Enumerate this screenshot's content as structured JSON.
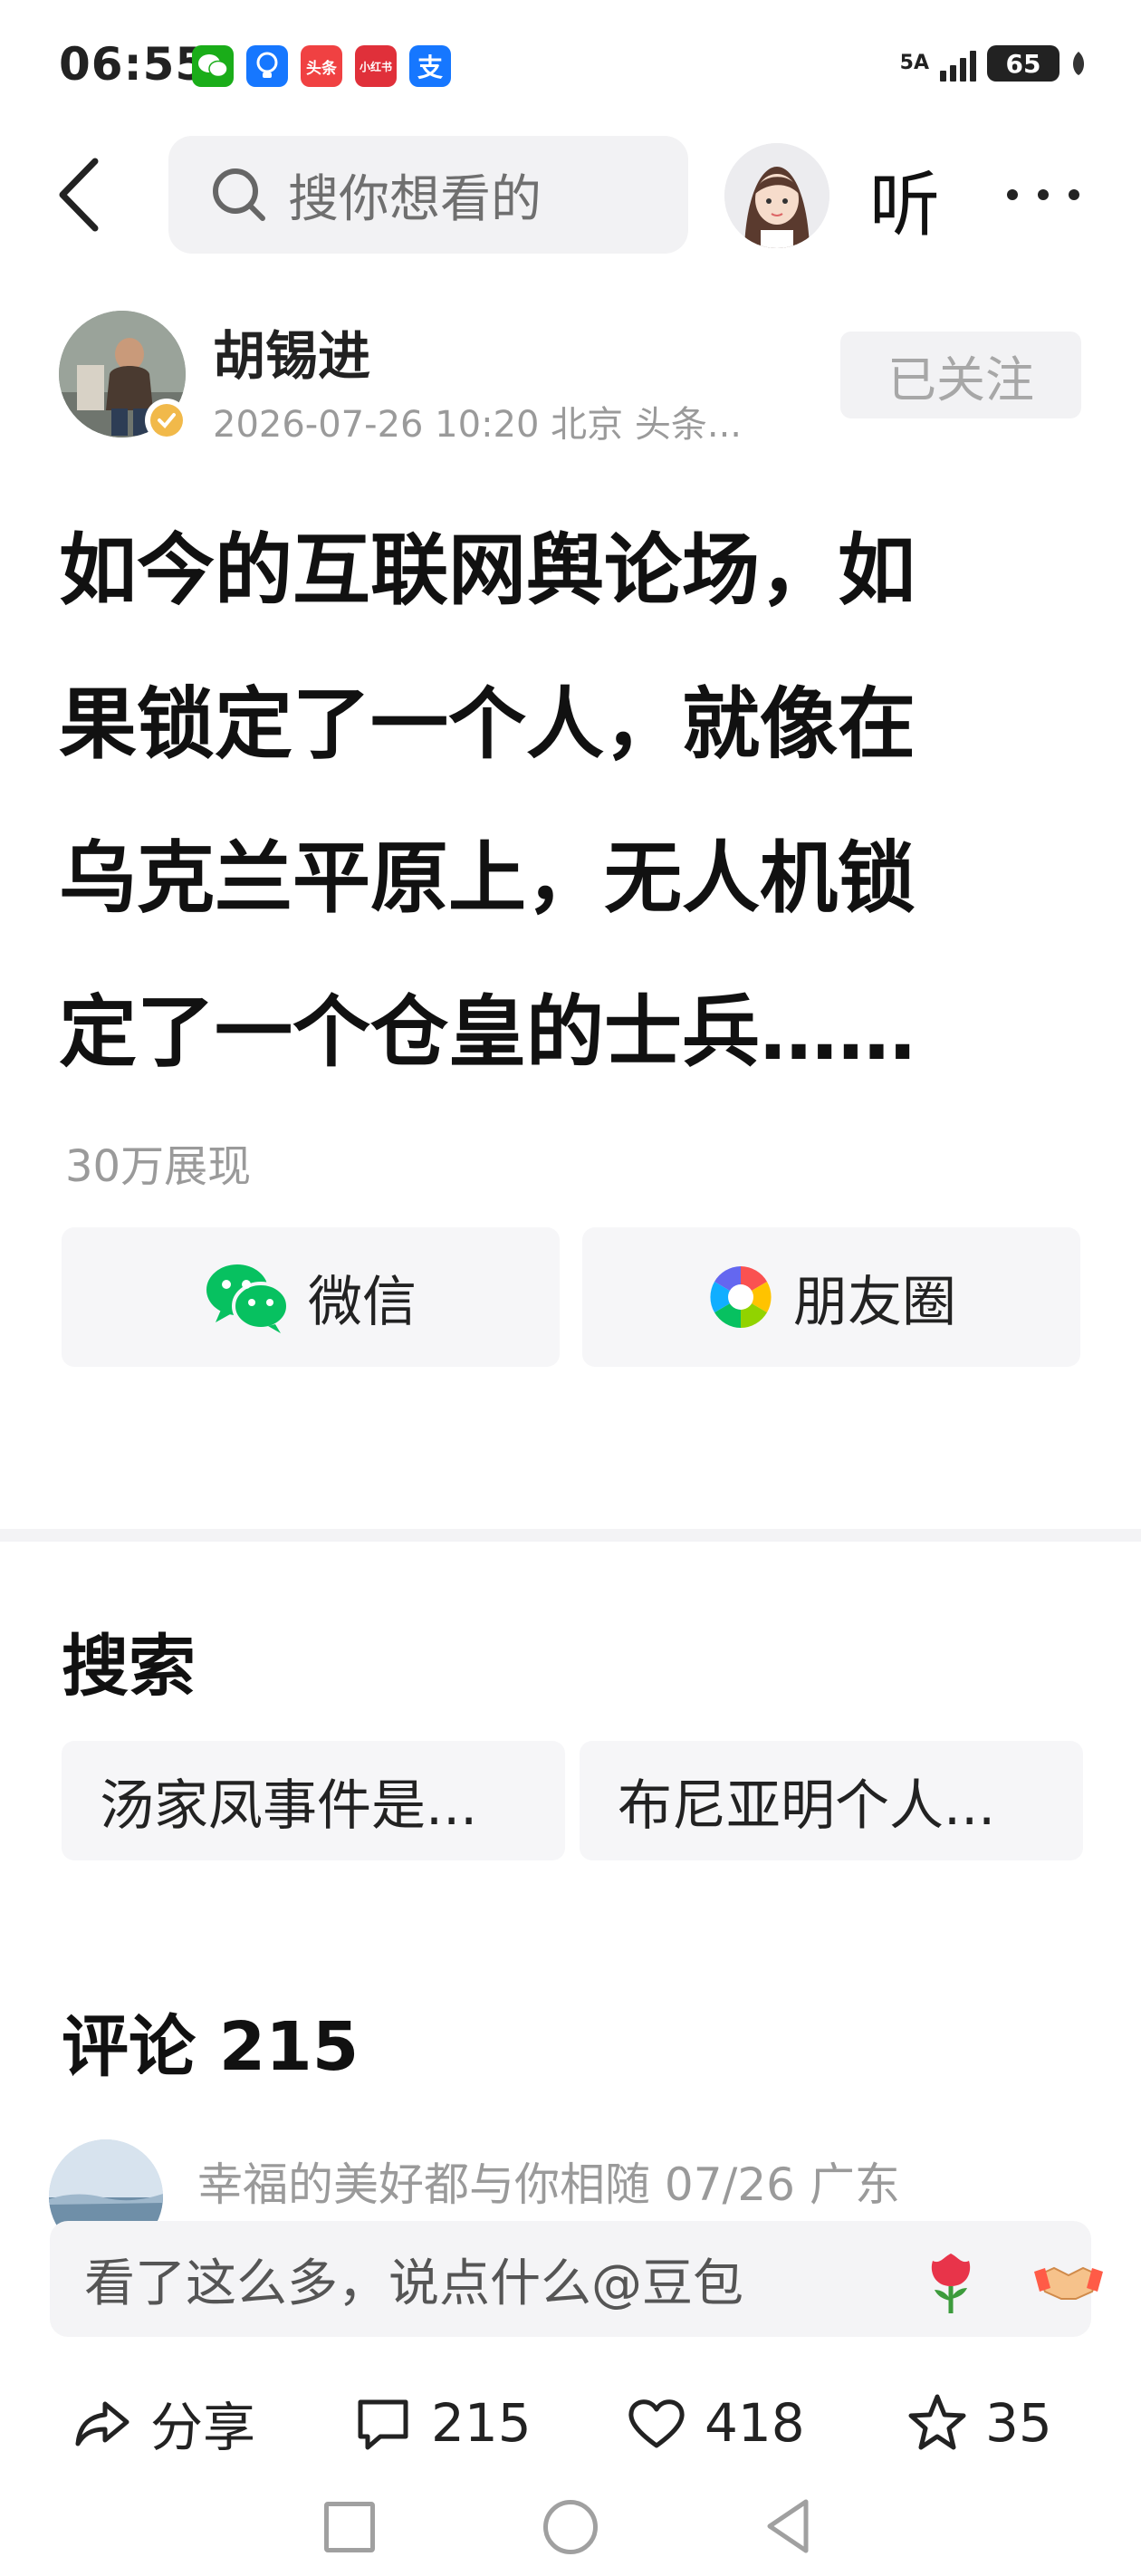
{
  "status_bar": {
    "time": "06:55",
    "network": "5A",
    "battery": "65",
    "app_icons": [
      {
        "name": "wechat-icon",
        "label": "",
        "color": "#1aad19"
      },
      {
        "name": "bulb-icon",
        "label": "",
        "color": "#1677ff"
      },
      {
        "name": "toutiao-icon",
        "label": "头条",
        "color": "#f04142"
      },
      {
        "name": "xiaohongshu-icon",
        "label": "小红书",
        "color": "#e0303a"
      },
      {
        "name": "alipay-icon",
        "label": "支",
        "color": "#1677ff"
      }
    ]
  },
  "header": {
    "search_placeholder": "搜你想看的",
    "listen_label": "听"
  },
  "author": {
    "name": "胡锡进",
    "meta": "2026-07-26 10:20 北京 头条...",
    "follow_label": "已关注"
  },
  "post": {
    "title_lines": [
      "如今的互联网舆论场，如",
      "果锁定了一个人，就像在",
      "乌克兰平原上，无人机锁",
      "定了一个仓皇的士兵……"
    ],
    "views": "30万展现"
  },
  "share": {
    "wechat_label": "微信",
    "moments_label": "朋友圈"
  },
  "search_section": {
    "title": "搜索",
    "chips": [
      "汤家凤事件是...",
      "布尼亚明个人..."
    ]
  },
  "comments": {
    "title": "评论 215",
    "first_comment_meta": "幸福的美好都与你相随  07/26  广东",
    "input_placeholder": "看了这么多，说点什么@豆包"
  },
  "actions": {
    "share_label": "分享",
    "comment_count": "215",
    "like_count": "418",
    "favorite_count": "35"
  },
  "colors": {
    "wechat_green": "#07c160",
    "muted_text": "#9a9a9a",
    "chip_bg": "#f6f6f8"
  }
}
